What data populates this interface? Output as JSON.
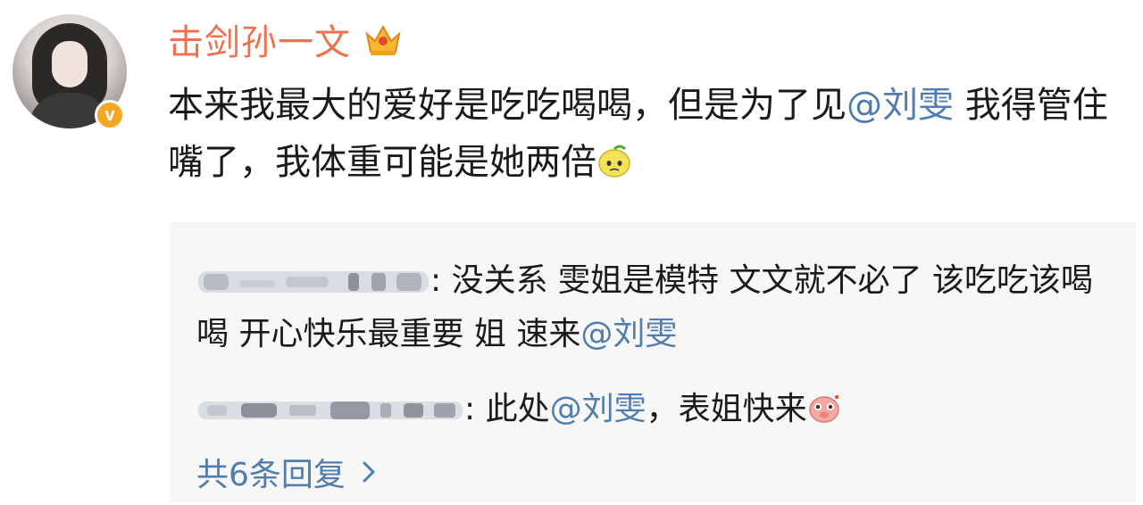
{
  "post": {
    "username": "击剑孙一文",
    "text_1": "本来我最大的爱好是吃吃喝喝，但是为了见",
    "mention_1": "@刘雯",
    "text_2": " 我得管住嘴了，我体重可能是她两倍"
  },
  "replies": [
    {
      "text_1": ": 没关系 雯姐是模特 文文就不必了 该吃吃该喝喝 开心快乐最重要 姐 速来",
      "mention": "@刘雯"
    },
    {
      "text_1": ": 此处",
      "mention": "@刘雯",
      "text_2": "，表姐快来"
    }
  ],
  "more_replies_label": "共6条回复",
  "icons": {
    "verified": "v-badge-icon",
    "crown": "crown-icon",
    "emoji_1": "lemon-face-icon",
    "emoji_2": "pig-face-icon",
    "more": "chevron-right-icon"
  },
  "colors": {
    "username": "#eb7350",
    "link": "#507daf",
    "badge": "#f5a623"
  }
}
